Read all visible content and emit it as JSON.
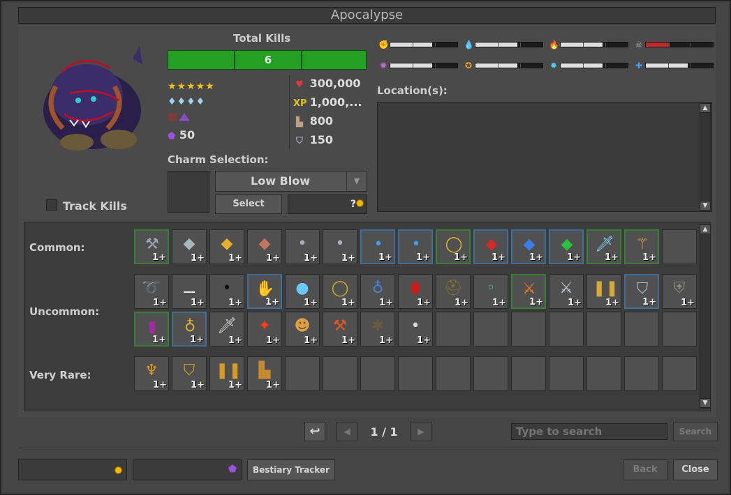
{
  "window": {
    "title": "Apocalypse"
  },
  "kills": {
    "label": "Total Kills",
    "count": "6"
  },
  "difficulty": {
    "stars": "★★★★★",
    "occurrence": "♦♦♦♦",
    "charm_points": "50"
  },
  "stats": {
    "hitpoints": "300,000",
    "experience": "1,000,...",
    "speed": "800",
    "armor": "150"
  },
  "resistances": [
    {
      "icon": "physical-icon",
      "color": "#dddddd",
      "level": 0.62
    },
    {
      "icon": "earth-icon",
      "color": "#5fcf5f",
      "level": 0.62
    },
    {
      "icon": "fire-icon",
      "color": "#ff6a1a",
      "level": 0.62
    },
    {
      "icon": "death-icon",
      "color": "#aaaaaa",
      "level": 0.35,
      "bar_color": "#c42a2a"
    },
    {
      "icon": "energy-icon",
      "color": "#c76ce0",
      "level": 0.62
    },
    {
      "icon": "holy-icon",
      "color": "#f0a030",
      "level": 0.62
    },
    {
      "icon": "ice-icon",
      "color": "#4fd0f0",
      "level": 0.62
    },
    {
      "icon": "life-drain-icon",
      "color": "#40a0ff",
      "level": 0.62
    }
  ],
  "locations": {
    "label": "Location(s):"
  },
  "track": {
    "label": "Track Kills"
  },
  "charm": {
    "label": "Charm Selection:",
    "selected": "Low Blow",
    "select_label": "Select",
    "cost": "?"
  },
  "loot": {
    "common_label": "Common:",
    "uncommon_label": "Uncommon:",
    "very_rare_label": "Very Rare:",
    "common": [
      {
        "name": "war-hammer-icon",
        "glyph": "⚒",
        "color": "#9aa6b5",
        "border": "g"
      },
      {
        "name": "silver-talisman-icon",
        "glyph": "◆",
        "color": "#a7b7c0",
        "border": ""
      },
      {
        "name": "gold-talisman-icon",
        "glyph": "◆",
        "color": "#e6b02c",
        "border": ""
      },
      {
        "name": "copper-talisman-icon",
        "glyph": "◆",
        "color": "#c2745f",
        "border": ""
      },
      {
        "name": "small-stone-icon",
        "glyph": "•",
        "color": "#aab0c0",
        "border": ""
      },
      {
        "name": "small-stone-icon",
        "glyph": "•",
        "color": "#aab0c0",
        "border": ""
      },
      {
        "name": "blue-pearl-icon",
        "glyph": "•",
        "color": "#3aa0ff",
        "border": "b"
      },
      {
        "name": "blue-pearl-icon",
        "glyph": "•",
        "color": "#3aa0ff",
        "border": "b"
      },
      {
        "name": "gold-ring-icon",
        "glyph": "◯",
        "color": "#e2c020",
        "border": "g"
      },
      {
        "name": "ruby-icon",
        "glyph": "◆",
        "color": "#d52a2a",
        "border": "b"
      },
      {
        "name": "sapphire-icon",
        "glyph": "◆",
        "color": "#3a7ee8",
        "border": "b"
      },
      {
        "name": "emerald-icon",
        "glyph": "◆",
        "color": "#2ac23a",
        "border": "b"
      },
      {
        "name": "ice-dagger-icon",
        "glyph": "🗡",
        "color": "#80d8ff",
        "border": "g"
      },
      {
        "name": "golden-staff-icon",
        "glyph": "⚚",
        "color": "#d8a040",
        "border": "g"
      }
    ],
    "uncommon_row1": [
      {
        "name": "golden-horn-icon",
        "glyph": "➰",
        "color": "#e6a820",
        "border": ""
      },
      {
        "name": "bone-icon",
        "glyph": "⚊",
        "color": "#e8e8e8",
        "border": ""
      },
      {
        "name": "black-pearl-icon",
        "glyph": "•",
        "color": "#111111",
        "border": ""
      },
      {
        "name": "claw-gloves-icon",
        "glyph": "✋",
        "color": "#c06a50",
        "border": "b"
      },
      {
        "name": "crystal-ball-icon",
        "glyph": "●",
        "color": "#6ac8ff",
        "border": ""
      },
      {
        "name": "gold-necklace-icon",
        "glyph": "◯",
        "color": "#d2b020",
        "border": ""
      },
      {
        "name": "sapphire-amulet-icon",
        "glyph": "♁",
        "color": "#4a80e0",
        "border": ""
      },
      {
        "name": "red-shield-icon",
        "glyph": "⬮",
        "color": "#d01a1a",
        "border": ""
      },
      {
        "name": "horned-helmet-icon",
        "glyph": "⛑",
        "color": "#8a6a30",
        "border": ""
      },
      {
        "name": "emerald-ring-icon",
        "glyph": "◦",
        "color": "#3ad0c0",
        "border": ""
      },
      {
        "name": "fire-axe-icon",
        "glyph": "⚔",
        "color": "#ff7a20",
        "border": "g"
      },
      {
        "name": "silver-sword-icon",
        "glyph": "⚔",
        "color": "#c8d0d8",
        "border": ""
      },
      {
        "name": "golden-legs-icon",
        "glyph": "❚❚",
        "color": "#d8a838",
        "border": ""
      },
      {
        "name": "steel-armor-icon",
        "glyph": "⛉",
        "color": "#b0b8c4",
        "border": "b"
      },
      {
        "name": "tower-shield-icon",
        "glyph": "⛨",
        "color": "#8a8a7a",
        "border": ""
      }
    ],
    "uncommon_row2": [
      {
        "name": "spellbook-icon",
        "glyph": "▮",
        "color": "#a02aa0",
        "border": "g"
      },
      {
        "name": "ring-icon",
        "glyph": "♁",
        "color": "#e0b030",
        "border": "b"
      },
      {
        "name": "dagger-icon",
        "glyph": "🗡",
        "color": "#d8d8d8",
        "border": ""
      },
      {
        "name": "fire-rune-icon",
        "glyph": "✦",
        "color": "#ff3a1a",
        "border": ""
      },
      {
        "name": "teddy-bear-icon",
        "glyph": "☻",
        "color": "#e0a040",
        "border": ""
      },
      {
        "name": "fire-hammer-icon",
        "glyph": "⚒",
        "color": "#e05a20",
        "border": ""
      },
      {
        "name": "spider-icon",
        "glyph": "✱",
        "color": "#6a5a40",
        "border": ""
      },
      {
        "name": "silver-pearl-icon",
        "glyph": "•",
        "color": "#d8d8d8",
        "border": ""
      }
    ],
    "very_rare": [
      {
        "name": "demon-helmet-icon",
        "glyph": "♆",
        "color": "#d89a20",
        "border": ""
      },
      {
        "name": "demon-armor-icon",
        "glyph": "⛉",
        "color": "#d89a20",
        "border": ""
      },
      {
        "name": "demon-legs-icon",
        "glyph": "❚❚",
        "color": "#d89a20",
        "border": ""
      },
      {
        "name": "demon-boots-icon",
        "glyph": "▙",
        "color": "#c88a30",
        "border": ""
      }
    ],
    "count_label": "1+"
  },
  "pager": {
    "page": "1 / 1"
  },
  "search": {
    "placeholder": "Type to search",
    "button": "Search"
  },
  "footer": {
    "tracker_label": "Bestiary Tracker",
    "back_label": "Back",
    "close_label": "Close"
  }
}
